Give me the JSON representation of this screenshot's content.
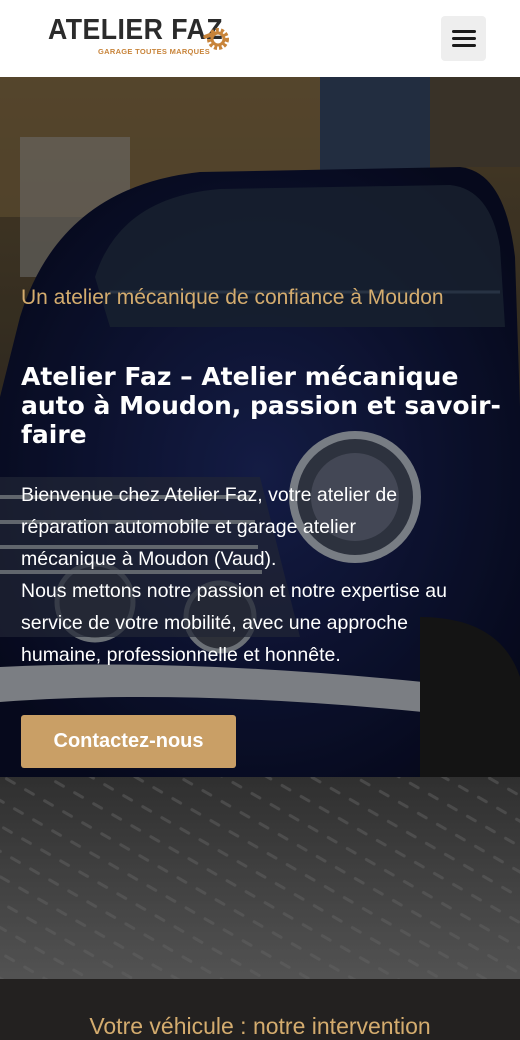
{
  "header": {
    "logo_text": "ATELIER FAZ",
    "logo_subtitle": "GARAGE TOUTES MARQUES",
    "menu_icon": "hamburger-icon"
  },
  "hero": {
    "kicker": "Un atelier mécanique de confiance à Moudon",
    "title": "Atelier Faz – Atelier mécanique auto à Moudon, passion et savoir-faire",
    "paragraph_lines": [
      "Bienvenue chez Atelier Faz, votre atelier de",
      "réparation automobile et garage atelier",
      "mécanique à Moudon (Vaud).",
      "Nous mettons notre passion et notre expertise au",
      "service de votre mobilité, avec une approche",
      "humaine, professionnelle et honnête."
    ],
    "cta_label": "Contactez-nous",
    "background_image": "classic-blue-mini-in-garage"
  },
  "section2": {
    "title": "Votre véhicule : notre intervention"
  },
  "colors": {
    "accent": "#c99f66",
    "kicker": "#d4ac6e",
    "header_bg": "#ffffff",
    "dark_bg": "#232120"
  }
}
